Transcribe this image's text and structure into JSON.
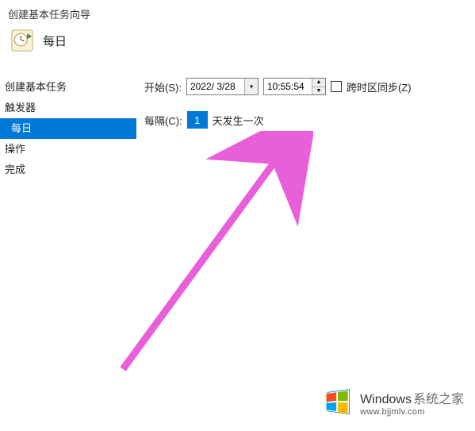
{
  "window": {
    "title": "创建基本任务向导"
  },
  "header": {
    "label": "每日"
  },
  "sidebar": {
    "items": [
      {
        "label": "创建基本任务",
        "selected": false,
        "indent": false
      },
      {
        "label": "触发器",
        "selected": false,
        "indent": false
      },
      {
        "label": "每日",
        "selected": true,
        "indent": true
      },
      {
        "label": "操作",
        "selected": false,
        "indent": false
      },
      {
        "label": "完成",
        "selected": false,
        "indent": false
      }
    ]
  },
  "form": {
    "start_label": "开始(S):",
    "date_value": "2022/ 3/28",
    "time_value": "10:55:54",
    "tz_sync_label": "跨时区同步(Z)",
    "interval_label": "每隔(C):",
    "interval_value": "1",
    "interval_suffix": "天发生一次"
  },
  "watermark": {
    "brand_main": "Windows",
    "brand_sub": "系统之家",
    "url": "www.bjjmlv.com"
  }
}
